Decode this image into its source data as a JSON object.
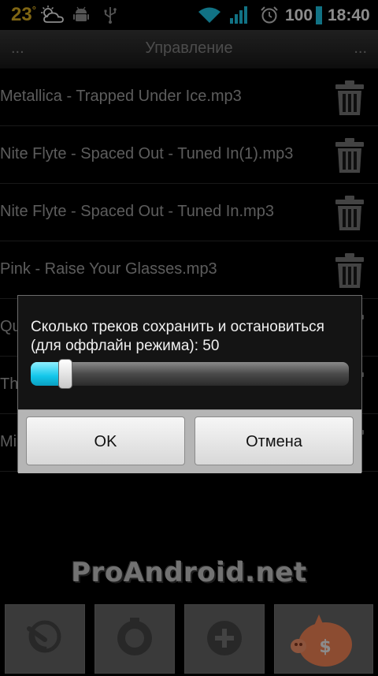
{
  "status_bar": {
    "weather_temp": "23",
    "weather_deg": "°",
    "battery": "100",
    "time": "18:40",
    "colors": {
      "temp": "#e8b824",
      "wifi": "#1fd0f0",
      "signal": "#1fd0f0",
      "battery": "#1fd0f0"
    },
    "icons": [
      "weather-cloud-sun-icon",
      "android-debug-icon",
      "usb-icon",
      "wifi-icon",
      "signal-icon",
      "alarm-icon",
      "battery-icon"
    ]
  },
  "header": {
    "left_dots": "...",
    "title": "Управление",
    "right_dots": "..."
  },
  "tracks": [
    {
      "name": "Metallica - Trapped Under Ice.mp3"
    },
    {
      "name": "Nite Flyte - Spaced Out - Tuned In(1).mp3"
    },
    {
      "name": "Nite Flyte - Spaced Out - Tuned In.mp3"
    },
    {
      "name": "Pink - Raise Your Glasses.mp3"
    },
    {
      "name": "Qu"
    },
    {
      "name": "Th"
    },
    {
      "name": "Mi"
    }
  ],
  "dialog": {
    "message": "Сколько треков сохранить и остановиться (для оффлайн режима): 50",
    "slider_value": 50,
    "slider_fraction": 0.11,
    "ok_label": "OK",
    "cancel_label": "Отмена",
    "accent": "#12c6ea"
  },
  "watermark": "ProAndroid.net",
  "toolbar": {
    "icons": [
      "refresh-icon",
      "settings-icon",
      "add-icon",
      "piggy-bank-icon"
    ],
    "piggy_color": "#ff8a5a"
  }
}
